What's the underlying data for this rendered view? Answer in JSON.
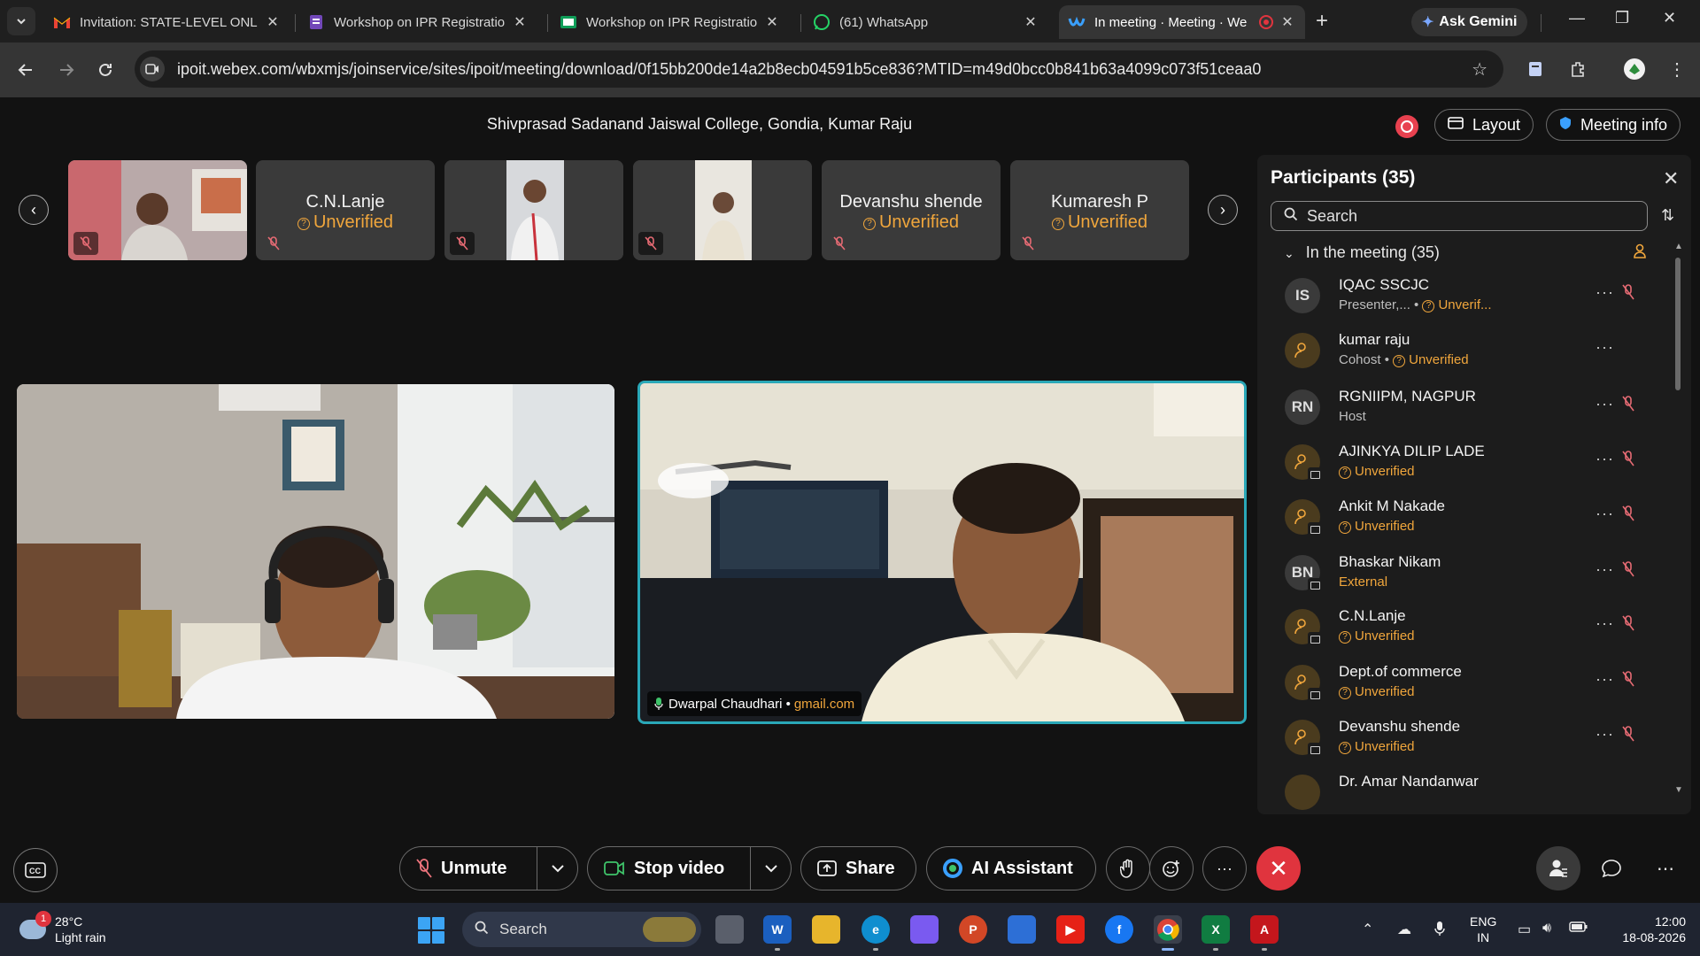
{
  "browser": {
    "tabs": [
      {
        "title": "Invitation: STATE-LEVEL ONLIN",
        "icon": "gmail-icon"
      },
      {
        "title": "Workshop on IPR Registration",
        "icon": "forms-icon"
      },
      {
        "title": "Workshop on IPR Registration",
        "icon": "sheets-icon"
      },
      {
        "title": "(61) WhatsApp",
        "icon": "whatsapp-icon"
      },
      {
        "title": "In meeting · Meeting · We",
        "icon": "webex-icon"
      }
    ],
    "gemini_label": "Ask Gemini",
    "url": "ipoit.webex.com/wbxmjs/joinservice/sites/ipoit/meeting/download/0f15bb200de14a2b8ecb04591b5ce836?MTID=m49d0bcc0b841b63a4099c073f51ceaa0"
  },
  "meeting": {
    "title": "Shivprasad Sadanand Jaiswal College, Gondia, Kumar Raju",
    "layout_label": "Layout",
    "info_label": "Meeting info",
    "thumbnails": [
      {
        "name": "",
        "status": "",
        "video": true
      },
      {
        "name": "C.N.Lanje",
        "status": "Unverified",
        "video": false
      },
      {
        "name": "",
        "status": "",
        "video": true
      },
      {
        "name": "",
        "status": "",
        "video": true
      },
      {
        "name": "Devanshu shende",
        "status": "Unverified",
        "video": false
      },
      {
        "name": "Kumaresh P",
        "status": "Unverified",
        "video": false
      }
    ],
    "main_video_label": {
      "name": "Dwarpal Chaudhari •",
      "email": "gmail.com"
    }
  },
  "participants": {
    "title": "Participants (35)",
    "search_placeholder": "Search",
    "group_label": "In the meeting (35)",
    "list": [
      {
        "initials": "IS",
        "name": "IQAC SSCJC",
        "role": "Presenter,...",
        "status": "Unverif..."
      },
      {
        "initials": "",
        "name": "kumar raju",
        "role": "Cohost",
        "status": "Unverified"
      },
      {
        "initials": "RN",
        "name": "RGNIIPM, NAGPUR",
        "role": "Host",
        "status": ""
      },
      {
        "initials": "",
        "name": "AJINKYA DILIP LADE",
        "role": "",
        "status": "Unverified"
      },
      {
        "initials": "",
        "name": "Ankit M Nakade",
        "role": "",
        "status": "Unverified"
      },
      {
        "initials": "BN",
        "name": "Bhaskar Nikam",
        "role": "",
        "status": "External"
      },
      {
        "initials": "",
        "name": "C.N.Lanje",
        "role": "",
        "status": "Unverified"
      },
      {
        "initials": "",
        "name": "Dept.of commerce",
        "role": "",
        "status": "Unverified"
      },
      {
        "initials": "",
        "name": "Devanshu shende",
        "role": "",
        "status": "Unverified"
      },
      {
        "initials": "",
        "name": "Dr. Amar Nandanwar",
        "role": "",
        "status": ""
      }
    ]
  },
  "controls": {
    "unmute": "Unmute",
    "stop_video": "Stop video",
    "share": "Share",
    "ai_assistant": "AI Assistant",
    "more": "···"
  },
  "taskbar": {
    "weather_badge": "1",
    "temperature": "28°C",
    "condition": "Light rain",
    "search": "Search",
    "lang_top": "ENG",
    "lang_bottom": "IN",
    "time": "12:00",
    "date": "18-08-2026"
  },
  "colors": {
    "accent_orange": "#f0a63c",
    "leave_red": "#e0343e",
    "active_speaker": "#2aa8b8"
  }
}
